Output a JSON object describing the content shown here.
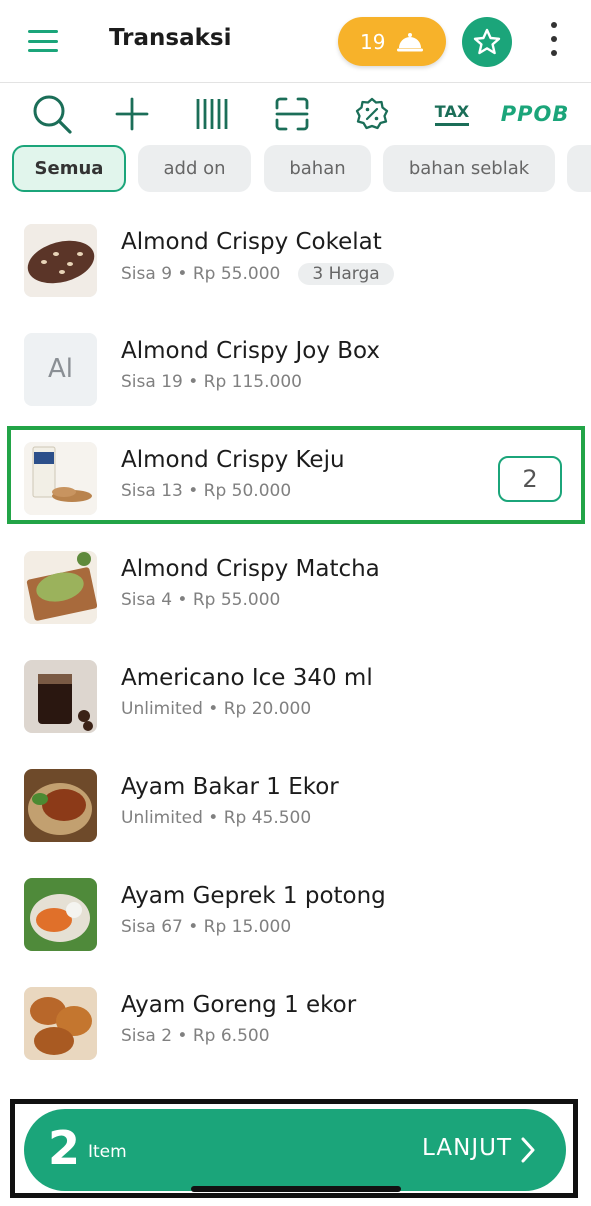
{
  "header": {
    "title": "Transaksi",
    "pending_orders_count": "19",
    "menu_icon": "hamburger-icon",
    "order_icon": "service-bell-icon",
    "favorite_icon": "star-icon",
    "more_icon": "kebab-icon"
  },
  "toolbar": {
    "tax_label": "TAX",
    "ppob_label": "PPOB",
    "icons": [
      "search-icon",
      "plus-icon",
      "barcode-icon",
      "scan-icon",
      "discount-icon"
    ]
  },
  "categories": {
    "items": [
      "Semua",
      "add on",
      "bahan",
      "bahan seblak",
      ""
    ],
    "selected": "Semua"
  },
  "products": [
    {
      "name": "Almond Crispy Cokelat",
      "meta": "Sisa 9 • Rp 55.000",
      "badge": "3 Harga",
      "thumb": "chocolate"
    },
    {
      "name": "Almond Crispy Joy Box",
      "meta": "Sisa 19 • Rp 115.000",
      "initials": "Al",
      "thumb": "initials"
    },
    {
      "name": "Almond Crispy Keju",
      "meta": "Sisa 13 • Rp 50.000",
      "quantity": "2",
      "thumb": "cheese"
    },
    {
      "name": "Almond Crispy Matcha",
      "meta": "Sisa 4 • Rp 55.000",
      "thumb": "matcha"
    },
    {
      "name": "Americano Ice 340 ml",
      "meta": "Unlimited • Rp 20.000",
      "thumb": "coffee"
    },
    {
      "name": "Ayam Bakar  1 Ekor",
      "meta": "Unlimited • Rp 45.500",
      "thumb": "grilled"
    },
    {
      "name": "Ayam Geprek 1 potong",
      "meta": "Sisa 67 • Rp 15.000",
      "thumb": "geprek"
    },
    {
      "name": "Ayam Goreng 1 ekor",
      "meta": "Sisa 2 • Rp 6.500",
      "thumb": "fried"
    }
  ],
  "cart": {
    "count": "2",
    "unit_label": "Item",
    "next_label": "LANJUT"
  },
  "colors": {
    "primary": "#1ba57a",
    "orders_pill": "#f7b22a",
    "selected_outline": "#22a447"
  }
}
